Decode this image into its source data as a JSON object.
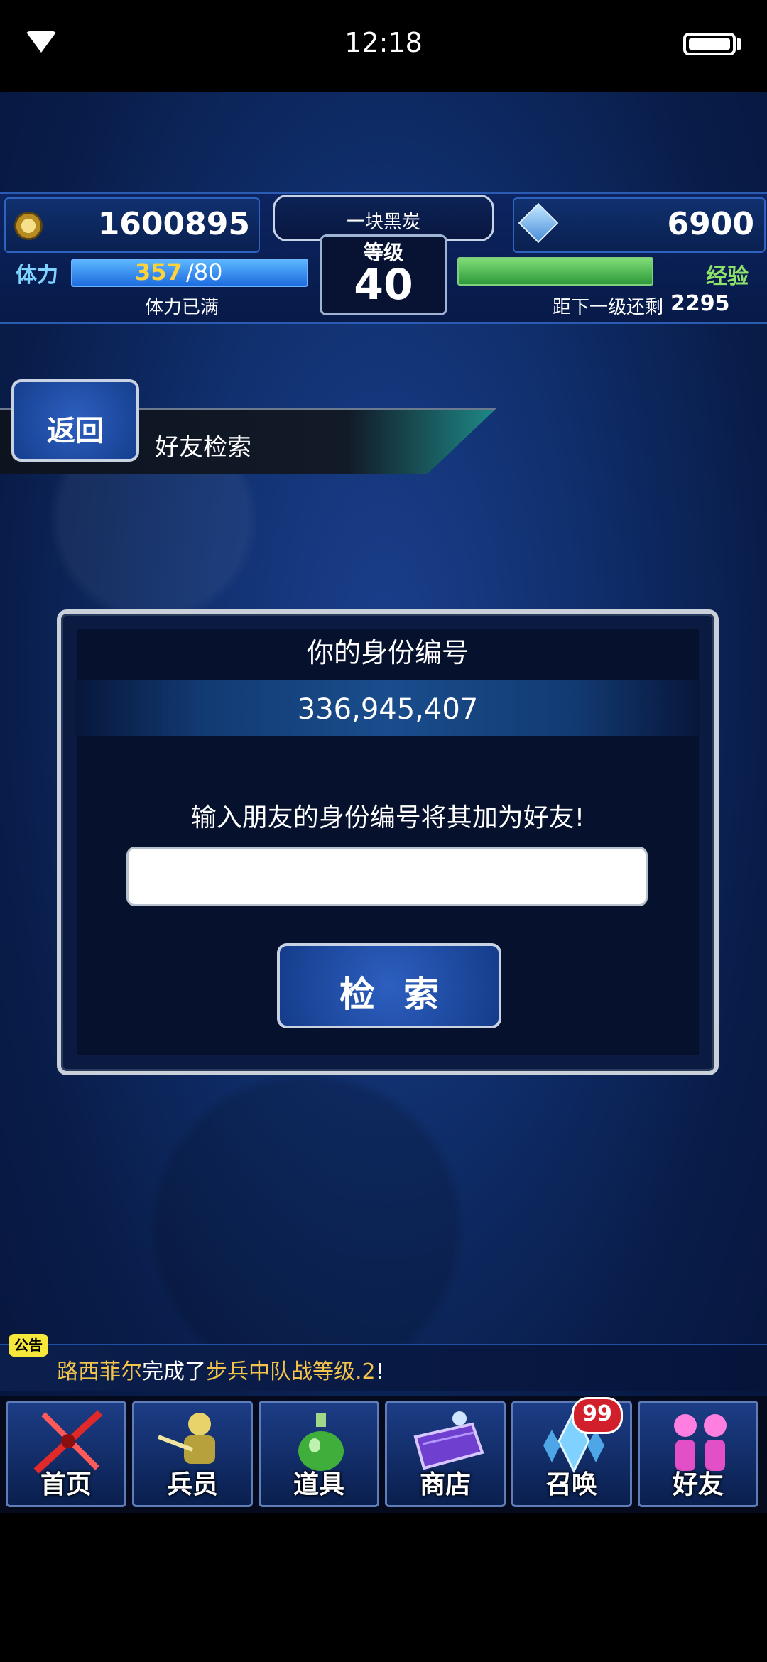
{
  "status_bar": {
    "time": "12:18"
  },
  "hud": {
    "gil": "1600895",
    "gems": "6900",
    "player_name": "一块黑炭",
    "level_label": "等级",
    "level": "40",
    "stamina_label": "体力",
    "stamina_current": "357",
    "stamina_max": "/80",
    "stamina_status": "体力已满",
    "exp_label": "经验",
    "exp_remaining_label": "距下一级还剩",
    "exp_remaining": "2295"
  },
  "header": {
    "back_label": "返回",
    "title": "好友检索"
  },
  "panel": {
    "title": "你的身份编号",
    "id_value": "336,945,407",
    "prompt": "输入朋友的身份编号将其加为好友!",
    "input_value": "",
    "search_label": "检索"
  },
  "announcement": {
    "badge": "公告",
    "player": "路西菲尔",
    "text1": "完成了",
    "event": "步兵中队战等级.2",
    "text2": "!"
  },
  "nav": {
    "items": [
      {
        "label": "首页",
        "icon": "sword-icon"
      },
      {
        "label": "兵员",
        "icon": "unit-icon"
      },
      {
        "label": "道具",
        "icon": "potion-icon"
      },
      {
        "label": "商店",
        "icon": "shop-icon"
      },
      {
        "label": "召唤",
        "icon": "crystal-icon",
        "badge": "99"
      },
      {
        "label": "好友",
        "icon": "friends-icon"
      }
    ]
  },
  "colors": {
    "accent_blue": "#1e6ddf",
    "exp_green": "#2e9a3a",
    "stamina_yellow": "#ffd23a",
    "badge_red": "#d21f2c"
  }
}
